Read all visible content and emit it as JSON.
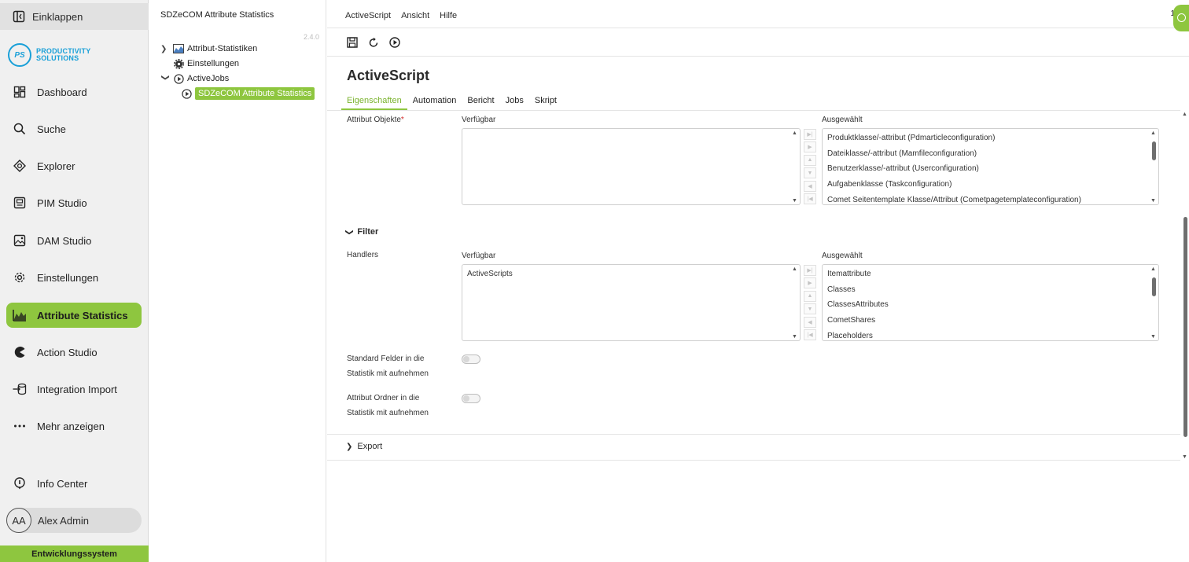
{
  "nav": {
    "collapse_label": "Einklappen",
    "logo": {
      "mark": "PS",
      "line1": "PRODUCTIVITY",
      "line2": "SOLUTIONS"
    },
    "items": [
      {
        "label": "Dashboard",
        "icon": "dashboard-icon"
      },
      {
        "label": "Suche",
        "icon": "search-icon"
      },
      {
        "label": "Explorer",
        "icon": "explorer-icon"
      },
      {
        "label": "PIM Studio",
        "icon": "pim-icon"
      },
      {
        "label": "DAM Studio",
        "icon": "image-icon"
      },
      {
        "label": "Einstellungen",
        "icon": "gear-icon"
      },
      {
        "label": "Attribute Statistics",
        "icon": "chart-icon",
        "active": true
      },
      {
        "label": "Action Studio",
        "icon": "pacman-icon"
      },
      {
        "label": "Integration Import",
        "icon": "import-icon"
      },
      {
        "label": "Mehr anzeigen",
        "icon": "more-icon"
      }
    ],
    "info_center": "Info Center",
    "user": {
      "initials": "AA",
      "name": "Alex Admin"
    },
    "environment": "Entwicklungssystem",
    "accent": "#8ec63f"
  },
  "tree": {
    "header": "SDZeCOM Attribute Statistics",
    "version": "2.4.0",
    "rows": [
      {
        "label": "Attribut-Statistiken"
      },
      {
        "label": "Einstellungen"
      },
      {
        "label": "ActiveJobs"
      },
      {
        "label": "SDZeCOM Attribute Statistics"
      }
    ]
  },
  "menu": {
    "items": [
      "ActiveScript",
      "Ansicht",
      "Hilfe"
    ],
    "corner": "1"
  },
  "page": {
    "title": "ActiveScript",
    "tabs": [
      "Eigenschaften",
      "Automation",
      "Bericht",
      "Jobs",
      "Skript"
    ],
    "active_tab": "Eigenschaften"
  },
  "attribute_objects": {
    "label": "Attribut Objekte",
    "required": "*",
    "available_label": "Verfügbar",
    "selected_label": "Ausgewählt",
    "available": [],
    "selected": [
      "Produktklasse/-attribut (Pdmarticleconfiguration)",
      "Dateiklasse/-attribut (Mamfileconfiguration)",
      "Benutzerklasse/-attribut (Userconfiguration)",
      "Aufgabenklasse (Taskconfiguration)",
      "Comet Seitentemplate Klasse/Attribut (Cometpagetemplateconfiguration)"
    ]
  },
  "filter": {
    "title": "Filter",
    "handlers": {
      "label": "Handlers",
      "available_label": "Verfügbar",
      "selected_label": "Ausgewählt",
      "available": [
        "ActiveScripts"
      ],
      "selected": [
        "Itemattribute",
        "Classes",
        "ClassesAttributes",
        "CometShares",
        "Placeholders"
      ]
    },
    "std_fields": {
      "line1": "Standard Felder in die",
      "line2": "Statistik mit aufnehmen"
    },
    "attr_folder": {
      "line1": "Attribut Ordner in die",
      "line2": "Statistik mit aufnehmen"
    }
  },
  "export": {
    "title": "Export"
  }
}
